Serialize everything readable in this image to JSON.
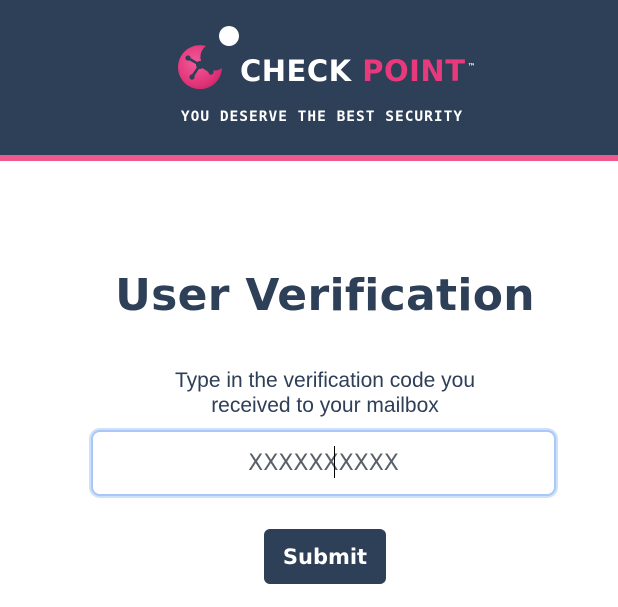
{
  "header": {
    "logo": {
      "word_1": "CHECK",
      "word_2": "POINT",
      "trademark": "™"
    },
    "tagline": "YOU DESERVE THE BEST SECURITY"
  },
  "main": {
    "title": "User Verification",
    "instructions": {
      "line_1": "Type in the verification code you",
      "line_2": "received to your mailbox"
    },
    "code_input": {
      "placeholder": "XXXXXXXXXX",
      "value": ""
    },
    "submit_label": "Submit"
  },
  "colors": {
    "header_bg": "#2e3f58",
    "accent_pink": "#e8397d",
    "stripe": "#ee5a8f",
    "focus_ring": "#a9c8f7"
  },
  "icons": {
    "logo_mark": "check-point-logo-icon"
  }
}
